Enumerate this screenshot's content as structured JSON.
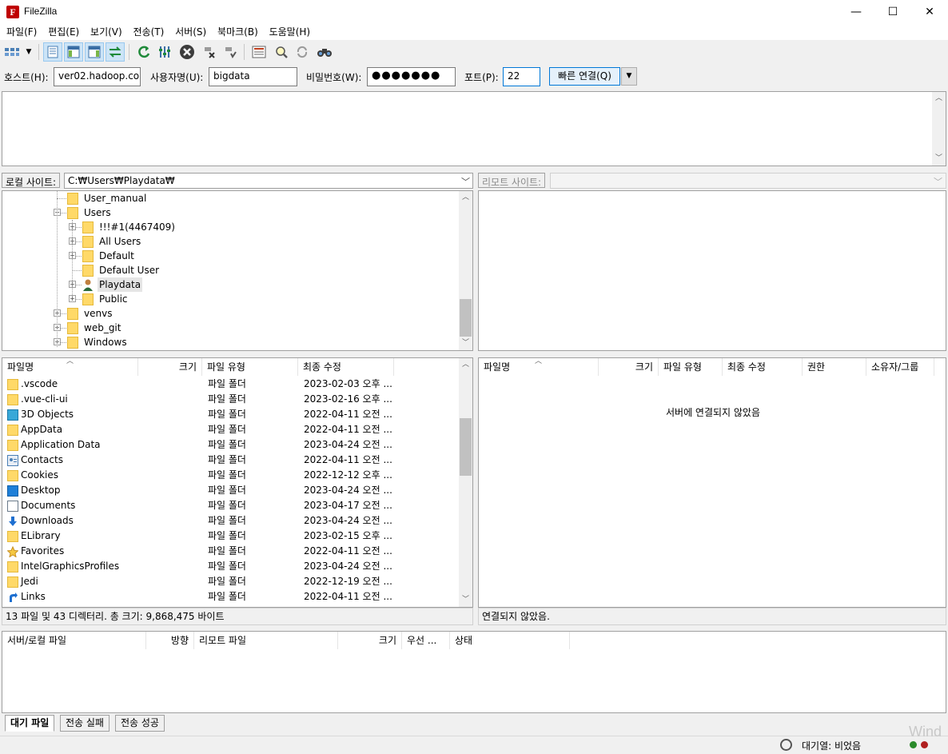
{
  "window": {
    "title": "FileZilla",
    "app_icon_letter": "F",
    "minimize": "—",
    "maximize": "☐",
    "close": "✕"
  },
  "menu": [
    "파일(F)",
    "편집(E)",
    "보기(V)",
    "전송(T)",
    "서버(S)",
    "북마크(B)",
    "도움말(H)"
  ],
  "quickconnect": {
    "host_label": "호스트(H):",
    "host_value": "ver02.hadoop.com",
    "user_label": "사용자명(U):",
    "user_value": "bigdata",
    "password_label": "비밀번호(W):",
    "password_value": "●●●●●●●",
    "port_label": "포트(P):",
    "port_value": "22",
    "connect_button": "빠른 연결(Q)"
  },
  "local": {
    "site_label": "로컬 사이트:",
    "site_path": "C:₩Users₩Playdata₩",
    "tree": [
      {
        "label": "User_manual",
        "level": 1,
        "expander": "",
        "icon": "folder-icon"
      },
      {
        "label": "Users",
        "level": 1,
        "expander": "−",
        "icon": "folder-icon"
      },
      {
        "label": "!!!#1(4467409)",
        "level": 2,
        "expander": "+",
        "icon": "folder-icon"
      },
      {
        "label": "All Users",
        "level": 2,
        "expander": "+",
        "icon": "folder-icon"
      },
      {
        "label": "Default",
        "level": 2,
        "expander": "+",
        "icon": "folder-icon"
      },
      {
        "label": "Default User",
        "level": 2,
        "expander": "",
        "icon": "folder-icon"
      },
      {
        "label": "Playdata",
        "level": 2,
        "expander": "+",
        "icon": "user-folder-icon",
        "selected": true
      },
      {
        "label": "Public",
        "level": 2,
        "expander": "+",
        "icon": "folder-icon"
      },
      {
        "label": "venvs",
        "level": 1,
        "expander": "+",
        "icon": "folder-icon"
      },
      {
        "label": "web_git",
        "level": 1,
        "expander": "+",
        "icon": "folder-icon"
      },
      {
        "label": "Windows",
        "level": 1,
        "expander": "+",
        "icon": "folder-icon"
      }
    ],
    "columns": [
      "파일명",
      "크기",
      "파일 유형",
      "최종 수정"
    ],
    "files": [
      {
        "name": ".vscode",
        "type": "파일 폴더",
        "modified": "2023-02-03 오후 ...",
        "icon": "folder-icon"
      },
      {
        "name": ".vue-cli-ui",
        "type": "파일 폴더",
        "modified": "2023-02-16 오후 ...",
        "icon": "folder-icon"
      },
      {
        "name": "3D Objects",
        "type": "파일 폴더",
        "modified": "2022-04-11 오전 ...",
        "icon": "3d-objects-icon"
      },
      {
        "name": "AppData",
        "type": "파일 폴더",
        "modified": "2022-04-11 오전 ...",
        "icon": "folder-icon"
      },
      {
        "name": "Application Data",
        "type": "파일 폴더",
        "modified": "2023-04-24 오전 ...",
        "icon": "folder-icon"
      },
      {
        "name": "Contacts",
        "type": "파일 폴더",
        "modified": "2022-04-11 오전 ...",
        "icon": "contacts-icon"
      },
      {
        "name": "Cookies",
        "type": "파일 폴더",
        "modified": "2022-12-12 오후 ...",
        "icon": "folder-icon"
      },
      {
        "name": "Desktop",
        "type": "파일 폴더",
        "modified": "2023-04-24 오전 ...",
        "icon": "desktop-icon"
      },
      {
        "name": "Documents",
        "type": "파일 폴더",
        "modified": "2023-04-17 오전 ...",
        "icon": "documents-icon"
      },
      {
        "name": "Downloads",
        "type": "파일 폴더",
        "modified": "2023-04-24 오전 ...",
        "icon": "downloads-icon"
      },
      {
        "name": "ELibrary",
        "type": "파일 폴더",
        "modified": "2023-02-15 오후 ...",
        "icon": "folder-icon"
      },
      {
        "name": "Favorites",
        "type": "파일 폴더",
        "modified": "2022-04-11 오전 ...",
        "icon": "favorites-icon"
      },
      {
        "name": "IntelGraphicsProfiles",
        "type": "파일 폴더",
        "modified": "2023-04-24 오전 ...",
        "icon": "folder-icon"
      },
      {
        "name": "Jedi",
        "type": "파일 폴더",
        "modified": "2022-12-19 오전 ...",
        "icon": "folder-icon"
      },
      {
        "name": "Links",
        "type": "파일 폴더",
        "modified": "2022-04-11 오전 ...",
        "icon": "links-icon"
      }
    ],
    "status": "13 파일 및 43 디렉터리. 총 크기: 9,868,475 바이트"
  },
  "remote": {
    "site_label": "리모트 사이트:",
    "site_path": "",
    "columns": [
      "파일명",
      "크기",
      "파일 유형",
      "최종 수정",
      "권한",
      "소유자/그룹"
    ],
    "empty_message": "서버에 연결되지 않았음",
    "status": "연결되지 않았음."
  },
  "queue": {
    "columns": [
      "서버/로컬 파일",
      "방향",
      "리모트 파일",
      "크기",
      "우선 ...",
      "상태"
    ],
    "tabs": [
      "대기 파일",
      "전송 실패",
      "전송 성공"
    ],
    "status": "대기열: 비었음"
  },
  "watermark": "Wind"
}
